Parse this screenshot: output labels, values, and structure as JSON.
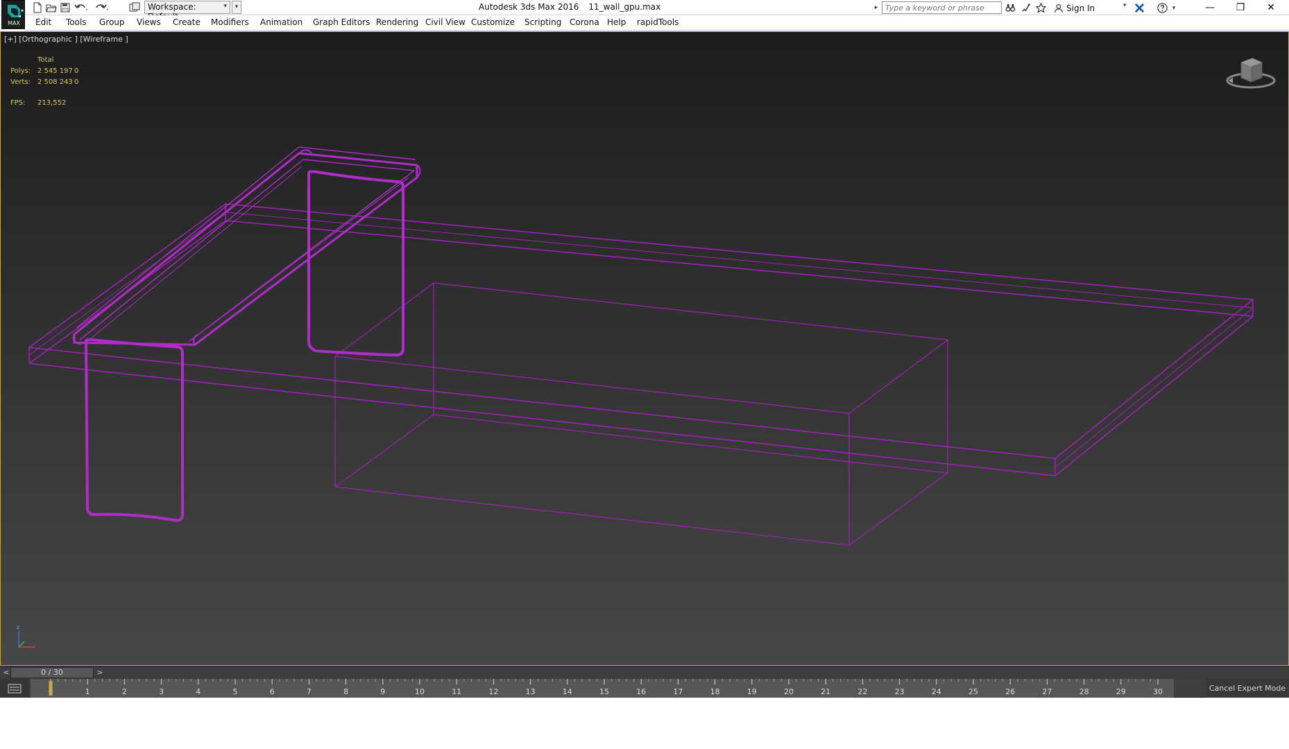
{
  "app": {
    "logo_text": "MAX",
    "window_title": "Autodesk 3ds Max 2016",
    "file_name": "11_wall_gpu.max",
    "accent_color": "#c8a84c",
    "wireframe_color": "#a020b8"
  },
  "quick_access": {
    "icons": [
      "new-file-icon",
      "open-file-icon",
      "save-icon",
      "undo-icon",
      "redo-icon",
      "project-icon"
    ],
    "workspace_label": "Workspace: Default"
  },
  "infocenter": {
    "search_placeholder": "Type a keyword or phrase",
    "sign_in_label": "Sign In",
    "icons": [
      "binoculars-icon",
      "communication-center-icon",
      "favorites-star-icon",
      "user-icon",
      "exchange-x-icon",
      "help-icon"
    ]
  },
  "window_controls": {
    "minimize": "—",
    "restore": "❐",
    "close": "✕"
  },
  "menu": {
    "items": [
      "Edit",
      "Tools",
      "Group",
      "Views",
      "Create",
      "Modifiers",
      "Animation",
      "Graph Editors",
      "Rendering",
      "Civil View",
      "Customize",
      "Scripting",
      "Corona",
      "Help",
      "rapidTools"
    ]
  },
  "viewport": {
    "label": "[+] [Orthographic ] [Wireframe ]",
    "stats": {
      "header": "Total",
      "polys_label": "Polys:",
      "polys_value": "2 545 197",
      "polys_sel": "0",
      "verts_label": "Verts:",
      "verts_value": "2 508 243",
      "verts_sel": "0",
      "fps_label": "FPS:",
      "fps_value": "213,552"
    },
    "axis_label": "z"
  },
  "timeline": {
    "prev": "<",
    "next": ">",
    "frame_display": "0 / 30",
    "current_frame": 0,
    "start": 0,
    "end": 30,
    "ticks": [
      "0",
      "1",
      "2",
      "3",
      "4",
      "5",
      "6",
      "7",
      "8",
      "9",
      "10",
      "11",
      "12",
      "13",
      "14",
      "15",
      "16",
      "17",
      "18",
      "19",
      "20",
      "21",
      "22",
      "23",
      "24",
      "25",
      "26",
      "27",
      "28",
      "29",
      "30"
    ],
    "cancel_expert_label": "Cancel Expert Mode"
  }
}
